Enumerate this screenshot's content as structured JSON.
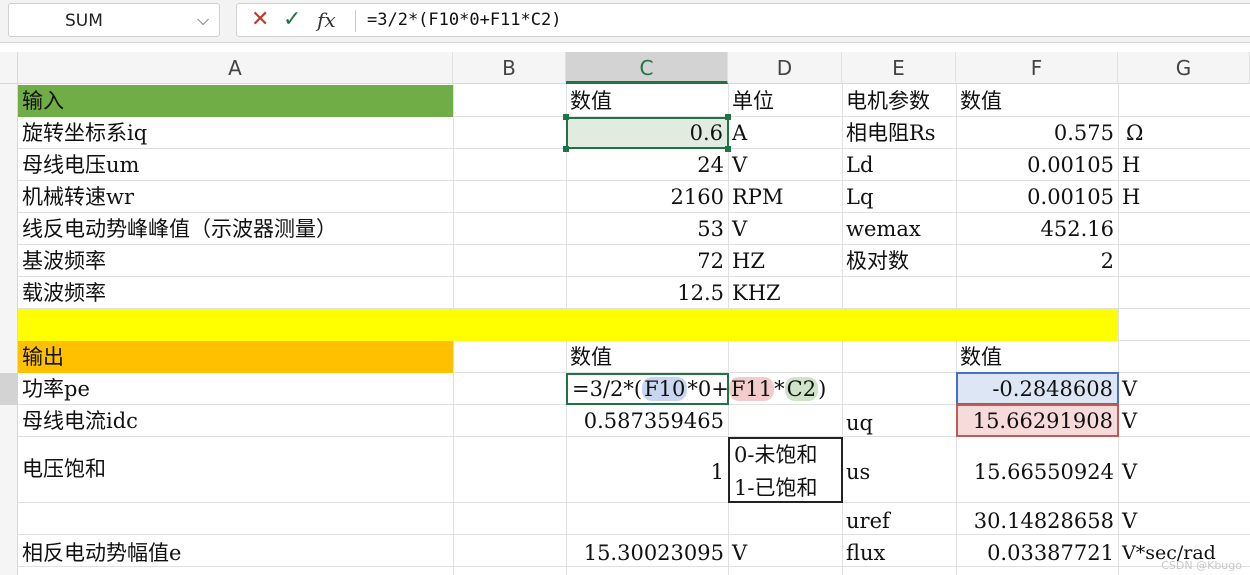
{
  "formula_bar": {
    "name_box": "SUM",
    "cancel_icon": "✕",
    "enter_icon": "✓",
    "fx_label": "fx",
    "formula": "=3/2*(F10*0+F11*C2)"
  },
  "columns": [
    "A",
    "B",
    "C",
    "D",
    "E",
    "F",
    "G"
  ],
  "cells": {
    "r1": {
      "A": "输入",
      "C": "数值",
      "D": "单位",
      "E": "电机参数",
      "F": "数值"
    },
    "r2": {
      "A": "旋转坐标系iq",
      "C": "0.6",
      "D": "A",
      "E": "相电阻Rs",
      "F": "0.575",
      "G": "Ω"
    },
    "r3": {
      "A": "母线电压um",
      "C": "24",
      "D": "V",
      "E": "Ld",
      "F": "0.00105",
      "G": "H"
    },
    "r4": {
      "A": "机械转速wr",
      "C": "2160",
      "D": "RPM",
      "E": "Lq",
      "F": "0.00105",
      "G": "H"
    },
    "r5": {
      "A": "线反电动势峰峰值（示波器测量）",
      "C": "53",
      "D": "V",
      "E": "wemax",
      "F": "452.16"
    },
    "r6": {
      "A": "基波频率",
      "C": "72",
      "D": "HZ",
      "E": "极对数",
      "F": "2"
    },
    "r7": {
      "A": "载波频率",
      "C": "12.5",
      "D": "KHZ"
    },
    "r9": {
      "A": "输出",
      "C": "数值",
      "F": "数值"
    },
    "r10": {
      "A": "功率pe",
      "C_parts": [
        "=3/2*(",
        "F10",
        "*0+",
        "F11",
        "*",
        "C2",
        ")"
      ],
      "F": "-0.2848608",
      "G": "V"
    },
    "r11": {
      "A": "母线电流idc",
      "C": "0.587359465",
      "E": "uq",
      "F": "15.66291908",
      "G": "V"
    },
    "r12": {
      "A": "电压饱和",
      "C": "1",
      "D_line1": "0-未饱和",
      "D_line2": "1-已饱和",
      "E": "us",
      "F": "15.66550924",
      "G": "V"
    },
    "r13": {
      "E": "uref",
      "F": "30.14828658",
      "G": "V"
    },
    "r14": {
      "A": "相反电动势幅值e",
      "C": "15.30023095",
      "D": "V",
      "E": "flux",
      "F": "0.03387721",
      "G": "V*sec/rad"
    }
  },
  "watermark": "CSDN @Kbugo"
}
